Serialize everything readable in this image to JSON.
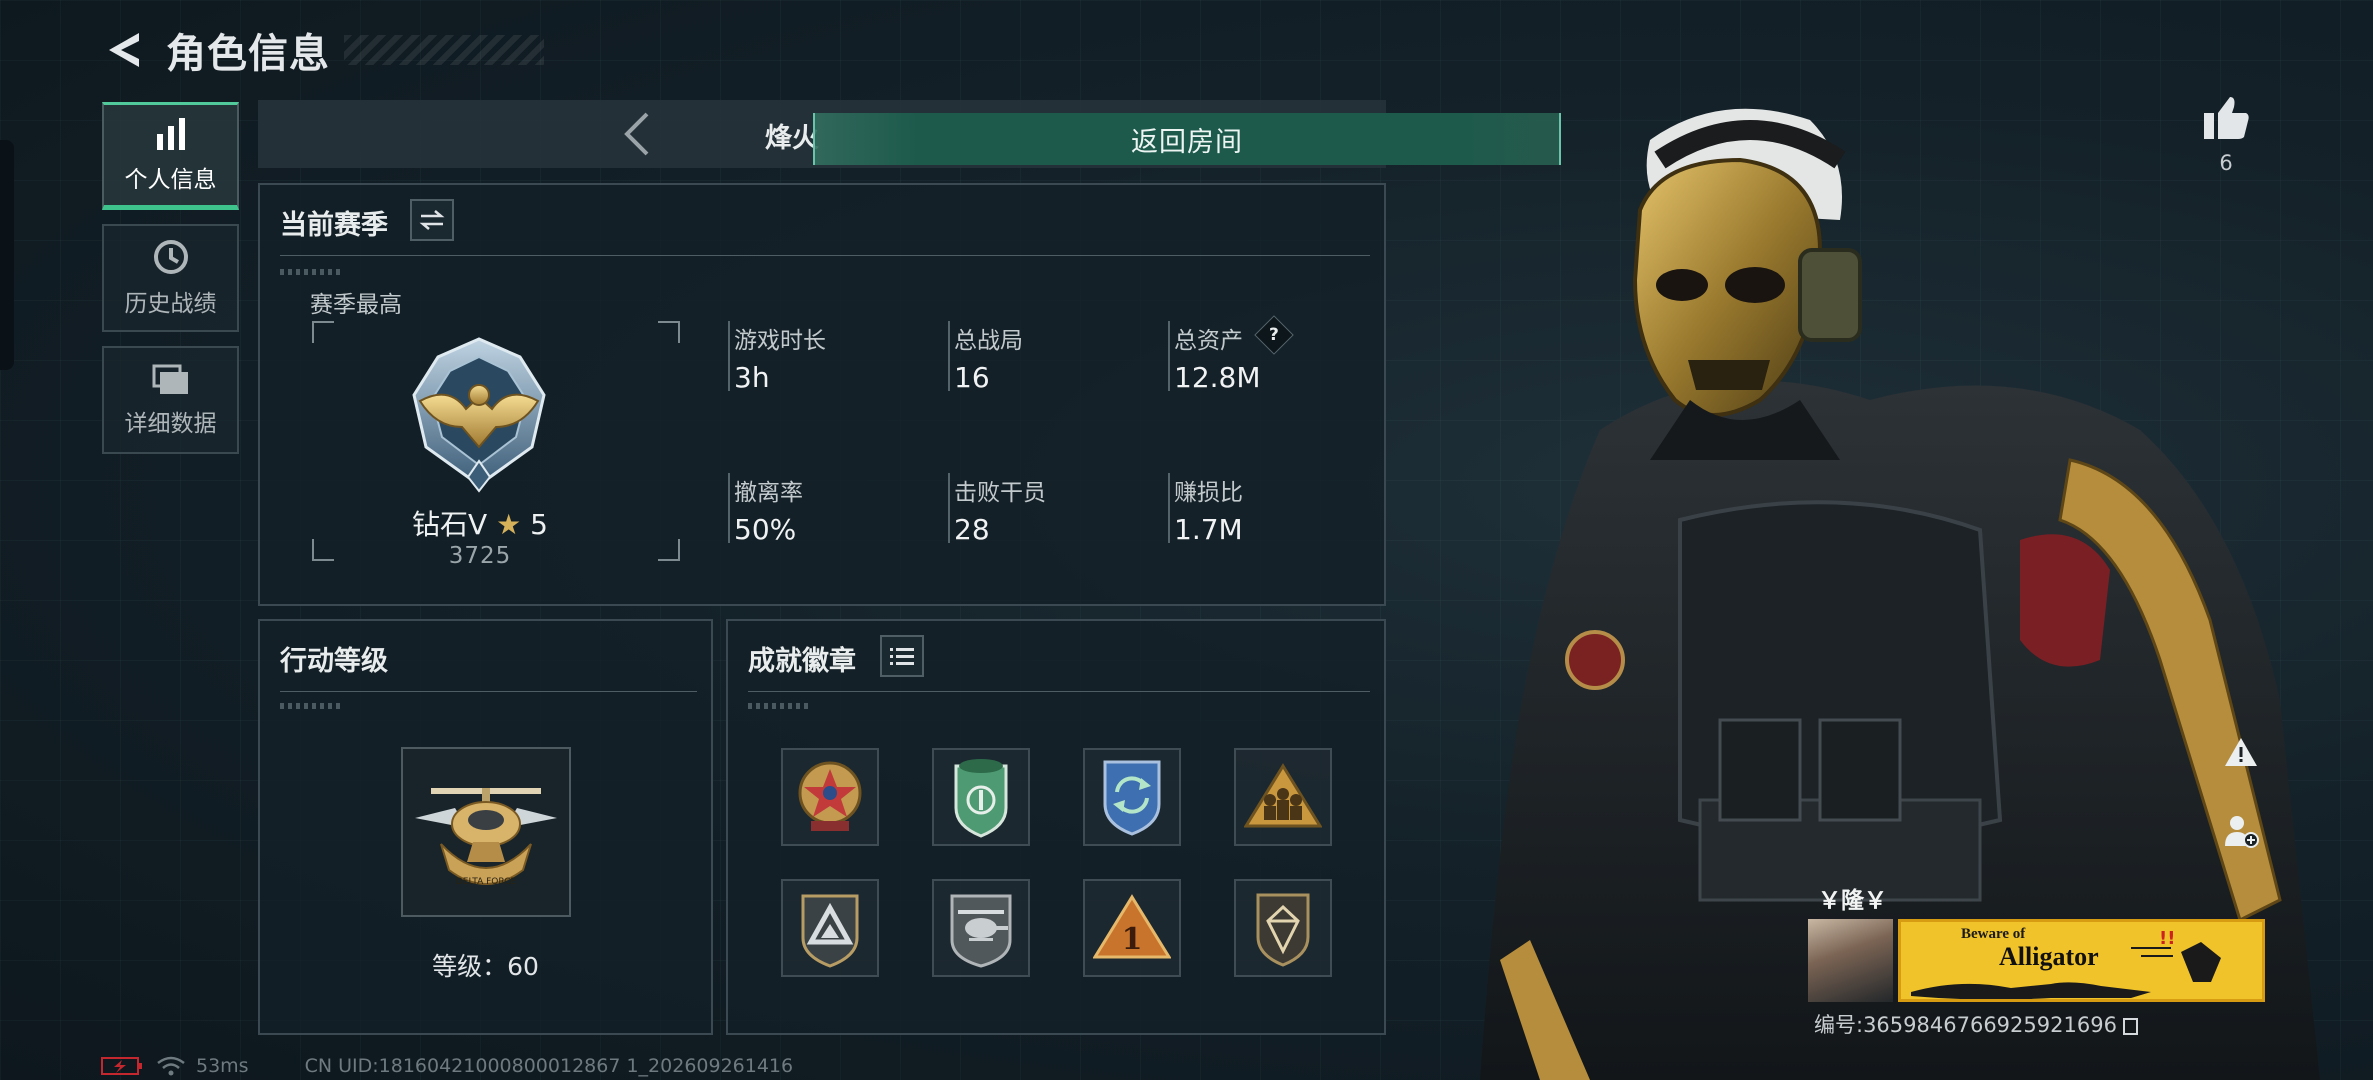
{
  "header": {
    "title": "角色信息"
  },
  "nav": [
    {
      "label": "个人信息",
      "icon": "bar-chart-icon",
      "active": true
    },
    {
      "label": "历史战绩",
      "icon": "history-clock-icon",
      "active": false
    },
    {
      "label": "详细数据",
      "icon": "folder-icon",
      "active": false
    }
  ],
  "season_bar": {
    "name": "烽火",
    "return_label": "返回房间"
  },
  "current_season": {
    "title": "当前赛季",
    "best_label": "赛季最高",
    "rank_name": "钻石V",
    "rank_stars": "5",
    "rank_score": "3725",
    "stats": [
      {
        "label": "游戏时长",
        "value": "3h"
      },
      {
        "label": "总战局",
        "value": "16"
      },
      {
        "label": "总资产",
        "value": "12.8M",
        "help": "?"
      },
      {
        "label": "撤离率",
        "value": "50%"
      },
      {
        "label": "击败干员",
        "value": "28"
      },
      {
        "label": "赚损比",
        "value": "1.7M"
      }
    ]
  },
  "action_level": {
    "title": "行动等级",
    "level_text": "等级：60"
  },
  "achievements": {
    "title": "成就徽章",
    "badges": [
      {
        "icon": "star-medal-badge-icon",
        "accent": "#c23a3a"
      },
      {
        "icon": "green-shield-badge-icon",
        "accent": "#4e9a72"
      },
      {
        "icon": "blue-cycle-badge-icon",
        "accent": "#3e6fb0"
      },
      {
        "icon": "gold-team-badge-icon",
        "accent": "#c8973e"
      },
      {
        "icon": "triangle-shield-badge-icon",
        "accent": "#8a8f92"
      },
      {
        "icon": "helicopter-badge-icon",
        "accent": "#9a9ea0"
      },
      {
        "icon": "number-one-badge-icon",
        "accent": "#c9742c"
      },
      {
        "icon": "crystal-shield-badge-icon",
        "accent": "#a8915e"
      }
    ]
  },
  "like": {
    "count": "6"
  },
  "player": {
    "name": "￥隆￥",
    "banner_small": "Beware of",
    "banner_big": "Alligator",
    "id_text": "编号:3659846766925921696"
  },
  "footer": {
    "ping": "53ms",
    "uid": "CN UID:18160421000800012867 1_202609261416"
  },
  "colors": {
    "accent_green": "#3fc38d",
    "button_green": "#1d5a4c",
    "banner_yellow": "#f1c32a",
    "gold": "#c8a45a"
  }
}
